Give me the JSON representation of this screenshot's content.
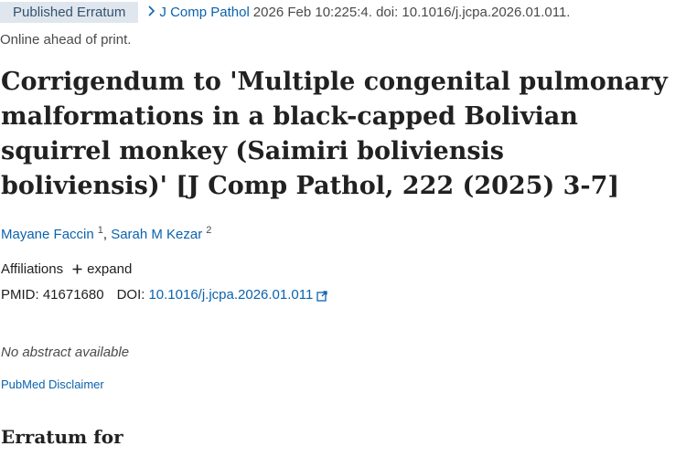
{
  "badge": "Published Erratum",
  "citation": {
    "journal": "J Comp Pathol",
    "rest": "2026 Feb 10:225:4. doi: 10.1016/j.jcpa.2026.01.011."
  },
  "ahead_of_print": "Online ahead of print.",
  "article_title": "Corrigendum to 'Multiple congenital pulmonary malformations in a black-capped Bolivian squirrel monkey (Saimiri boliviensis boliviensis)' [J Comp Pathol, 222 (2025) 3-7]",
  "authors": [
    {
      "name": "Mayane Faccin",
      "sup": "1"
    },
    {
      "name": "Sarah M Kezar",
      "sup": "2"
    }
  ],
  "affiliations": {
    "label": "Affiliations",
    "expand_label": "expand"
  },
  "identifiers": {
    "pmid_label": "PMID:",
    "pmid": "41671680",
    "doi_label": "DOI:",
    "doi": "10.1016/j.jcpa.2026.01.011"
  },
  "no_abstract": "No abstract available",
  "disclaimer_link": "PubMed Disclaimer",
  "erratum_heading": "Erratum for",
  "icons": {
    "chevron": "chevron-right-icon",
    "expand": "plus-icon",
    "external": "external-link-icon"
  },
  "colors": {
    "link": "#0b63ae",
    "badge_bg": "#dfe6ee",
    "badge_text": "#36526d",
    "text": "#212121",
    "muted": "#4a4a4a"
  }
}
